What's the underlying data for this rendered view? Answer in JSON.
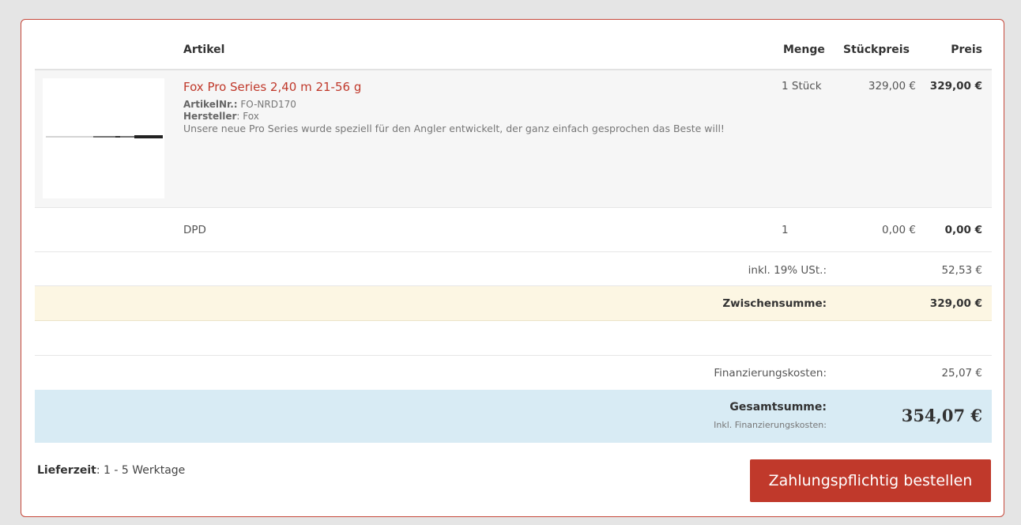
{
  "table": {
    "headers": {
      "article": "Artikel",
      "quantity": "Menge",
      "unit_price": "Stückpreis",
      "price": "Preis"
    }
  },
  "product": {
    "name": "Fox Pro Series 2,40 m 21-56 g",
    "article_no_label": "ArtikelNr.:",
    "article_no": "FO-NRD170",
    "manufacturer_label": "Hersteller",
    "manufacturer": "Fox",
    "description": "Unsere neue Pro Series wurde speziell für den Angler entwickelt, der ganz einfach gesprochen das Beste will!",
    "quantity": "1 Stück",
    "unit_price": "329,00 €",
    "price": "329,00 €"
  },
  "shipping": {
    "name": "DPD",
    "quantity": "1",
    "unit_price": "0,00 €",
    "price": "0,00 €"
  },
  "summary": {
    "vat_label": "inkl. 19% USt.:",
    "vat_value": "52,53 €",
    "subtotal_label": "Zwischensumme:",
    "subtotal_value": "329,00 €",
    "financing_label": "Finanzierungskosten:",
    "financing_value": "25,07 €",
    "total_label": "Gesamtsumme:",
    "total_sublabel": "Inkl. Finanzierungskosten:",
    "total_value": "354,07 €"
  },
  "footer": {
    "delivery_label": "Lieferzeit",
    "delivery_value": ": 1 - 5 Werktage",
    "order_button": "Zahlungspflichtig bestellen"
  },
  "colors": {
    "accent": "#c0392b",
    "subtotal_bg": "#fcf6e3",
    "total_bg": "#d8ebf4"
  }
}
